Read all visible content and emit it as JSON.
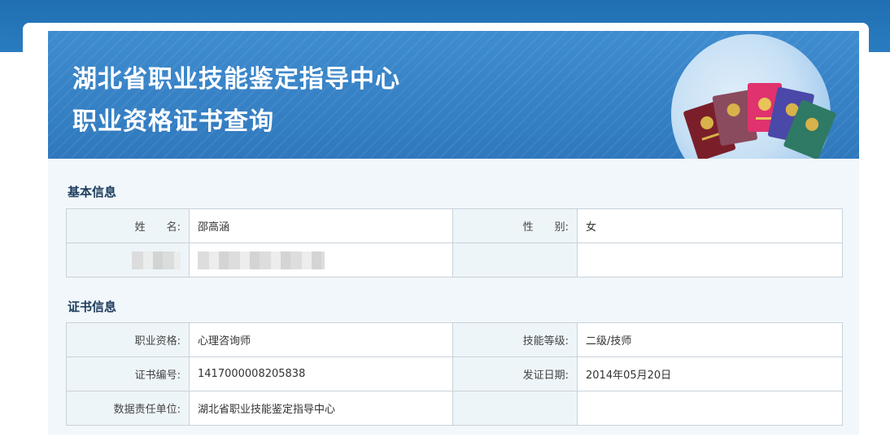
{
  "banner": {
    "title_line1": "湖北省职业技能鉴定指导中心",
    "title_line2": "职业资格证书查询"
  },
  "basic_info": {
    "section_title": "基本信息",
    "rows": [
      {
        "label1": "姓　　名:",
        "value1": "邵高涵",
        "label2": "性　　别:",
        "value2": "女"
      },
      {
        "label1": "",
        "value1": "",
        "label2": "",
        "value2": ""
      }
    ]
  },
  "cert_info": {
    "section_title": "证书信息",
    "rows": [
      {
        "label1": "职业资格:",
        "value1": "心理咨询师",
        "label2": "技能等级:",
        "value2": "二级/技师"
      },
      {
        "label1": "证书编号:",
        "value1": "1417000008205838",
        "label2": "发证日期:",
        "value2": "2014年05月20日"
      },
      {
        "label1": "数据责任单位:",
        "value1": "湖北省职业技能鉴定指导中心",
        "label2": "",
        "value2": ""
      }
    ]
  },
  "colors": {
    "banner_blue": "#3b86c8",
    "top_strip": "#1f6fb2",
    "content_bg": "#f1f7fb",
    "label_bg": "#eef5f9",
    "section_title": "#1d3c5d"
  },
  "icons": [
    "certificate-booklets-illustration"
  ]
}
